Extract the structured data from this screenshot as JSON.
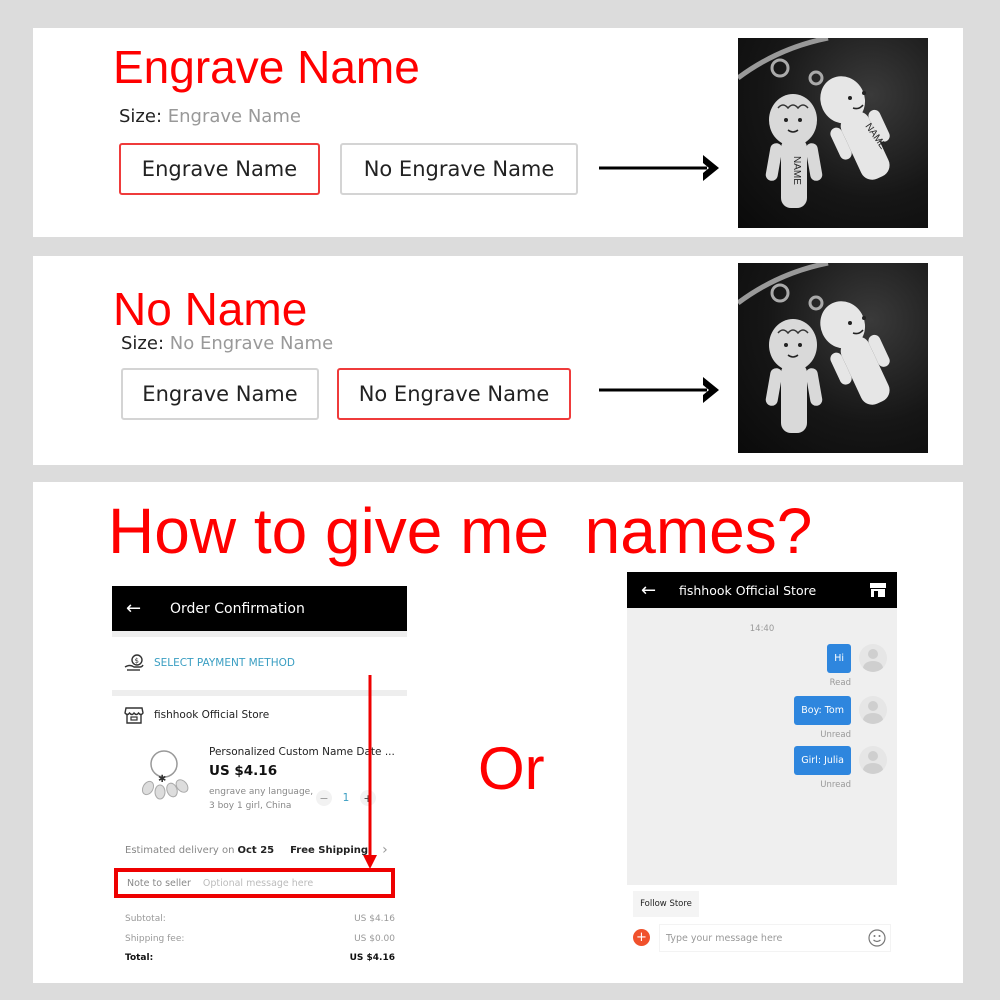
{
  "panel_engrave": {
    "title": "Engrave Name",
    "size_label": "Size:",
    "size_value": "Engrave Name",
    "options": [
      {
        "label": "Engrave Name",
        "selected": true
      },
      {
        "label": "No Engrave Name",
        "selected": false
      }
    ],
    "photo": {
      "engraved_text": "NAME",
      "alt": "Boy and girl keychain with NAME engraved"
    }
  },
  "panel_no_name": {
    "title": "No Name",
    "size_label": "Size:",
    "size_value": "No Engrave Name",
    "options": [
      {
        "label": "Engrave Name",
        "selected": false
      },
      {
        "label": "No Engrave Name",
        "selected": true
      }
    ],
    "photo": {
      "alt": "Boy and girl keychain without engraving"
    }
  },
  "panel_how": {
    "title": "How to give me  names?",
    "or_text": "Or",
    "order_screen": {
      "header_title": "Order Confirmation",
      "back_icon": "arrow-left-icon",
      "payment_label": "SELECT PAYMENT METHOD",
      "store_name": "fishhook Official Store",
      "product": {
        "title": "Personalized Custom Name Date ...",
        "price": "US $4.16",
        "desc_line1": "engrave any language,",
        "desc_line2": "3 boy 1 girl, China",
        "quantity": "1",
        "minus": "−",
        "plus": "+"
      },
      "delivery": {
        "estimated_label": "Estimated delivery on",
        "date": "Oct 25",
        "shipping": "Free Shipping",
        "chevron": "›"
      },
      "note": {
        "label": "Note to seller",
        "placeholder": "Optional message here"
      },
      "summary": [
        {
          "label": "Subtotal:",
          "value": "US $4.16"
        },
        {
          "label": "Shipping fee:",
          "value": "US $0.00"
        },
        {
          "label": "Total:",
          "value": "US $4.16"
        }
      ]
    },
    "chat_screen": {
      "header_title": "fishhook Official Store",
      "back_icon": "arrow-left-icon",
      "time": "14:40",
      "messages": [
        {
          "text": "Hi",
          "status": "Read"
        },
        {
          "text": "Boy: Tom",
          "status": "Unread"
        },
        {
          "text": "Girl: Julia",
          "status": "Unread"
        }
      ],
      "follow_label": "Follow Store",
      "plus": "+",
      "input_placeholder": "Type your message here"
    }
  },
  "colors": {
    "accent_red": "#ff0000",
    "selected_border": "#ef3b3b",
    "link_blue": "#3a9ec2",
    "bubble_blue": "#2e86de",
    "add_orange": "#f0512c"
  }
}
